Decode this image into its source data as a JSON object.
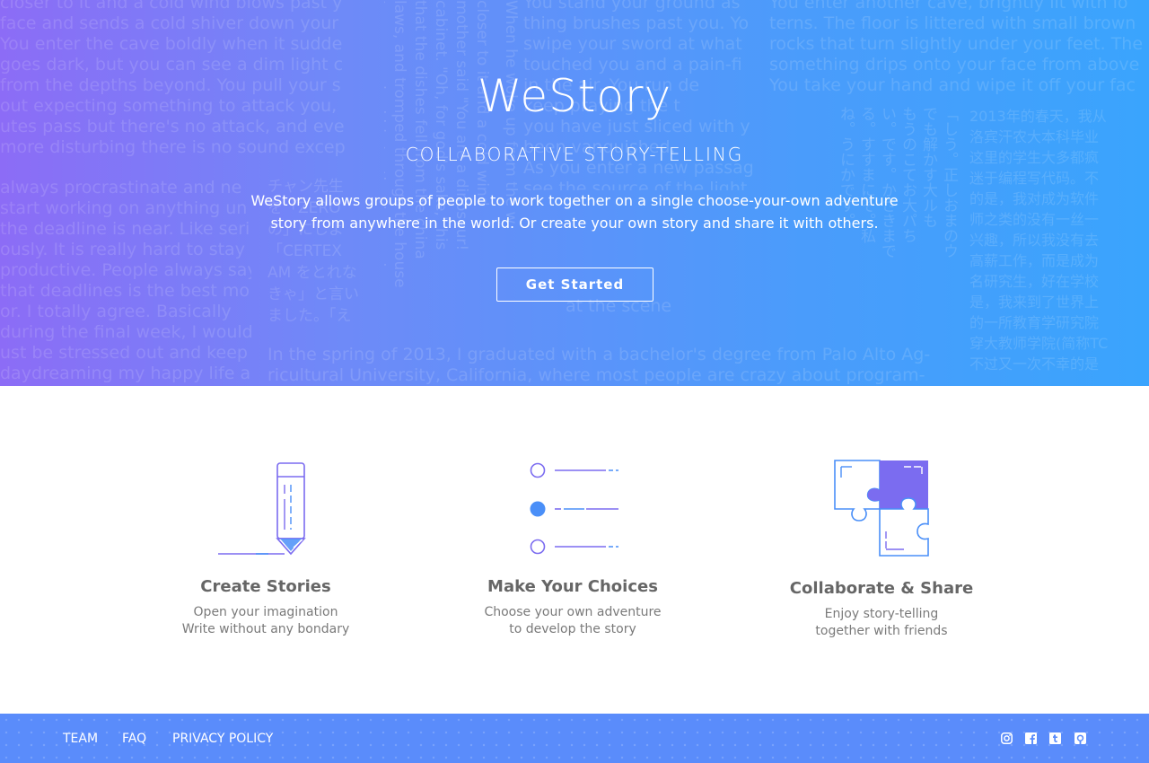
{
  "hero": {
    "logo": "WeStory",
    "tagline": "COLLABORATIVE STORY-TELLING",
    "description_line1": "WeStory allows groups of people to work  together on a single choose-your-own adventure",
    "description_line2": "story from anywhere in the world. Or create your own story and share it with others.",
    "cta_label": "Get Started",
    "gradient": [
      "#8c6cf6",
      "#3aa4fd"
    ],
    "background_text": {
      "block1": "closer to it and a cold wind blows past y\nface and sends a cold shiver down your\nYou enter the cave boldly when it sudde\ngoes dark, but you can see a dim light c\nfrom the depths beyond. You pull your s\nout expecting something to attack you,\nutes pass but there's no attack, and eve\nmore disturbing there is no sound excep",
      "block2": "always procrastinate and ne\nstart working on anything un\nthe deadline is near. Like seri\nously. It is really hard to stay\nproductive. People always say\nthat deadlines is the best mo\nor. I totally agree. Basically\nduring the final week, I would\nust be stressed out and keep\ndaydreaming my happy life a",
      "block3": "You stand your ground as\nthing brushes past you. Yo\nswipe your sword at what\ntouched you and a pain-fi\nin the air. You run de\nkeep praying the t\nyou have just sliced with y\nbeen vanquished.\nAs you enter a new passag\nsee the source of the light",
      "block4": "You enter another cave, brightly lit with lo\nterns. The floor is littered with small brown\nrocks that turn slightly under your feet. The\nsomething drips onto your face from above\nYou take your hand and wipe it off your fac",
      "block5": "In the spring of 2013, I graduated with a bachelor's degree from Palo Alto Ag-\nricultural University, California, where most people are crazy about program-",
      "block6": "2013年的春天，我从\n洛宾汗农大本科毕业\n这里的学生大多都疯\n迷于编程写代码。不\n的是，我对成为软件\n师之类的没有一丝一\n兴趣，所以我没有去\n高薪工作，而是成为\n名研究生，好在学校\n是，我来到了世界上\n的一所教育学研究院\n穿大教师学院(简称TC\n不过又一次不幸的是\n",
      "block7": "チャン先生\nを「ZERO\nの」にしよ\n「CERTEX\nAM をとれな\nきゃ」と言い\nました。「え\nえ、そんな。",
      "vert1": "closer to it and a cold wind\nmother said \"You are a dinosaur!\ncabinet. \"Oh, for god's sake,\" his\nthat the dishes fell from the china\nlaws, and tromped through the house\nterns, gnashed his teeth, his massi",
      "vert2": "When he woke up from the w",
      "vert3": "at the scene",
      "vert4": "「しう。正しおまのウ\nでも解かす大ルも\nもうのこてお大パち\nい。です。かさきまで\nる。すすまにそ。私\nね。うにかです。"
    }
  },
  "features": [
    {
      "icon": "pencil-icon",
      "title": "Create Stories",
      "line1": "Open your imagination",
      "line2": "Write without any bondary"
    },
    {
      "icon": "choices-list-icon",
      "title": "Make Your Choices",
      "line1": "Choose your own adventure",
      "line2": "to develop the story"
    },
    {
      "icon": "puzzle-icon",
      "title": "Collaborate & Share",
      "line1": "Enjoy story-telling",
      "line2": "together with friends"
    }
  ],
  "footer": {
    "links": [
      "TEAM",
      "FAQ",
      "PRIVACY POLICY"
    ],
    "social": [
      "instagram-icon",
      "facebook-icon",
      "tumblr-icon",
      "github-icon"
    ],
    "background_color": "#5a8cfb"
  },
  "colors": {
    "accent_purple": "#7b6cf0",
    "accent_blue": "#4a8ff8",
    "title_gray": "#666666",
    "text_gray": "#7a7a7a"
  }
}
